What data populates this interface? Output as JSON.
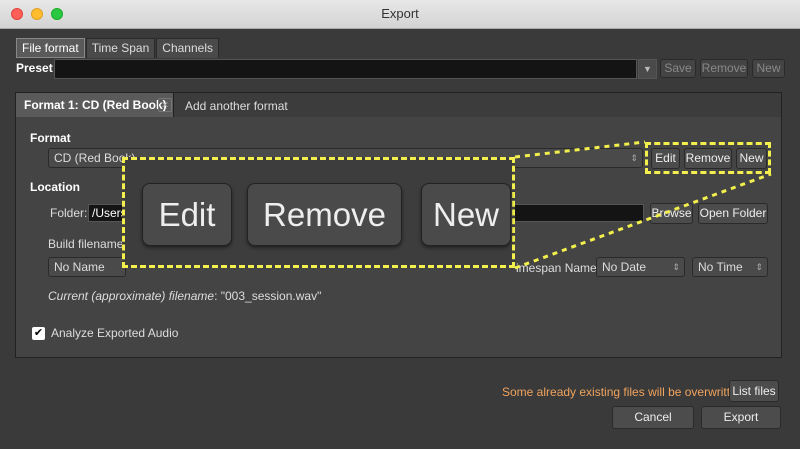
{
  "window": {
    "title": "Export"
  },
  "tabs": [
    "File format",
    "Time Span",
    "Channels"
  ],
  "preset": {
    "label": "Preset",
    "value": "",
    "save": "Save",
    "remove": "Remove",
    "new": "New"
  },
  "format_tabs": {
    "active": "Format 1: CD (Red Book)",
    "add": "Add another format"
  },
  "format": {
    "label": "Format",
    "value": "CD (Red Book)",
    "edit": "Edit",
    "remove": "Remove",
    "new": "New"
  },
  "location": {
    "label": "Location",
    "folder_label": "Folder:",
    "folder_value": "/Users",
    "browse": "Browse",
    "open_folder": "Open Folder"
  },
  "filename": {
    "label": "Build filename(s",
    "first_value": "No Name",
    "timespan_label": "imespan Name",
    "date_value": "No Date",
    "time_value": "No Time",
    "current_label": "Current (approximate) filename",
    "current_value": ": \"003_session.wav\""
  },
  "analyze": {
    "label": "Analyze Exported Audio",
    "checked": true
  },
  "zoom": {
    "edit": "Edit",
    "remove": "Remove",
    "new": "New"
  },
  "footer": {
    "warning": "Some already existing files will be overwritten.",
    "list_files": "List files",
    "cancel": "Cancel",
    "export": "Export"
  },
  "colors": {
    "highlight": "#f3f04e",
    "warning": "#f0a35e"
  }
}
